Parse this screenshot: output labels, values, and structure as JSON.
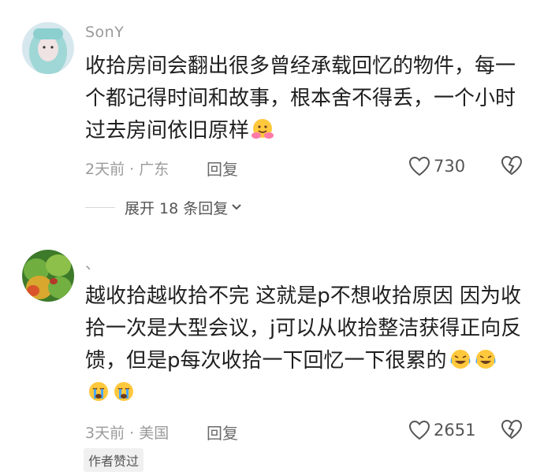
{
  "comments": [
    {
      "username": "SonY",
      "text": "收拾房间会翻出很多曾经承载回忆的物件，每一个都记得时间和故事，根本舍不得丢，一个小时过去房间依旧原样",
      "emojis": [
        "hug-emoji"
      ],
      "time_location": "2天前 · 广东",
      "reply_label": "回复",
      "likes": "730",
      "expand_label": "展开 18 条回复"
    },
    {
      "username": "、",
      "text": "越收拾越收拾不完 这就是p不想收拾原因 因为收拾一次是大型会议，j可以从收拾整洁获得正向反馈，但是p每次收拾一下回忆一下很累的",
      "emojis": [
        "laugh-cry-emoji",
        "laugh-cry-emoji",
        "crying-emoji",
        "crying-emoji"
      ],
      "time_location": "3天前 · 美国",
      "reply_label": "回复",
      "likes": "2651",
      "author_badge": "作者赞过"
    }
  ]
}
